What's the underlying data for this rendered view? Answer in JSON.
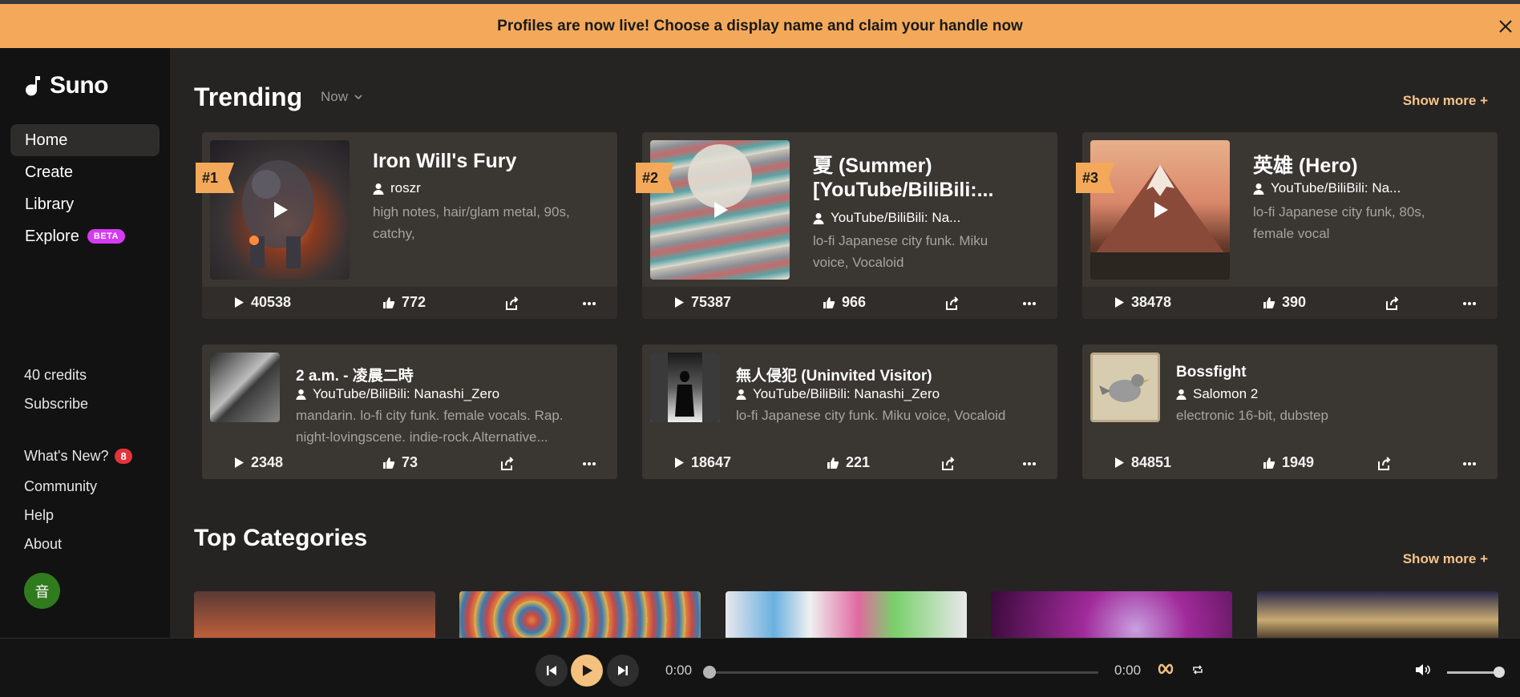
{
  "banner": {
    "text": "Profiles are now live! Choose a display name and claim your handle now"
  },
  "brand": {
    "name": "Suno"
  },
  "nav": [
    {
      "label": "Home"
    },
    {
      "label": "Create"
    },
    {
      "label": "Library"
    },
    {
      "label": "Explore",
      "badge": "BETA"
    }
  ],
  "account": {
    "credits": "40 credits",
    "subscribe": "Subscribe"
  },
  "links": {
    "whats_new": "What's New?",
    "whats_new_count": "8",
    "community": "Community",
    "help": "Help",
    "about": "About"
  },
  "avatar": {
    "initial": "音"
  },
  "trending": {
    "title": "Trending",
    "filter": "Now",
    "show_more": "Show more +",
    "featured": [
      {
        "rank": "#1",
        "title": "Iron Will's Fury",
        "title2": "",
        "user": "roszr",
        "tags": "high notes, hair/glam metal, 90s,",
        "tags2": "catchy,",
        "plays": "40538",
        "likes": "772"
      },
      {
        "rank": "#2",
        "title": "夏 (Summer)",
        "title2": "[YouTube/BiliBili:...",
        "user": "YouTube/BiliBili: Na...",
        "tags": "lo-fi Japanese city funk. Miku",
        "tags2": "voice, Vocaloid",
        "plays": "75387",
        "likes": "966"
      },
      {
        "rank": "#3",
        "title": "英雄 (Hero)",
        "title2": "",
        "user": "YouTube/BiliBili: Na...",
        "tags": "lo-fi Japanese city funk, 80s,",
        "tags2": "female vocal",
        "plays": "38478",
        "likes": "390"
      }
    ],
    "more": [
      {
        "title": "2 a.m. - 凌晨二時",
        "user": "YouTube/BiliBili: Nanashi_Zero",
        "tags": "mandarin. lo-fi city funk. female vocals. Rap.",
        "tags2": "night-lovingscene. indie-rock.Alternative...",
        "plays": "2348",
        "likes": "73"
      },
      {
        "title": "無人侵犯 (Uninvited Visitor)",
        "user": "YouTube/BiliBili: Nanashi_Zero",
        "tags": "lo-fi Japanese city funk. Miku voice, Vocaloid",
        "tags2": "",
        "plays": "18647",
        "likes": "221"
      },
      {
        "title": "Bossfight",
        "user": "Salomon 2",
        "tags": "electronic 16-bit, dubstep",
        "tags2": "",
        "plays": "84851",
        "likes": "1949"
      }
    ]
  },
  "categories": {
    "title": "Top Categories",
    "show_more": "Show more +"
  },
  "player": {
    "current_time": "0:00",
    "duration": "0:00",
    "progress": 0,
    "volume": 0.85
  }
}
